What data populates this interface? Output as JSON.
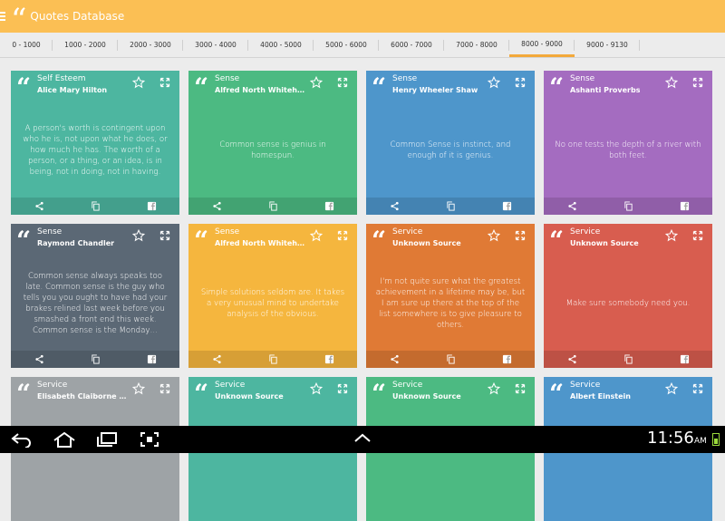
{
  "app": {
    "title": "Quotes Database",
    "logo_glyph": "“"
  },
  "tabs": [
    {
      "label": "0 - 1000",
      "active": false
    },
    {
      "label": "1000 - 2000",
      "active": false
    },
    {
      "label": "2000 - 3000",
      "active": false
    },
    {
      "label": "3000 - 4000",
      "active": false
    },
    {
      "label": "4000 - 5000",
      "active": false
    },
    {
      "label": "5000 - 6000",
      "active": false
    },
    {
      "label": "6000 - 7000",
      "active": false
    },
    {
      "label": "7000 - 8000",
      "active": false
    },
    {
      "label": "8000 - 9000",
      "active": true
    },
    {
      "label": "9000 - 9130",
      "active": false
    }
  ],
  "cards": [
    {
      "category": "Self Esteem",
      "author": "Alice Mary Hilton",
      "quote": "A person's worth is contingent upon who he is, not upon what he does, or how much he has. The worth of a person, or a thing, or an idea, is in being, not in doing, not in having.",
      "color": "#4db6a0"
    },
    {
      "category": "Sense",
      "author": "Alfred North Whitehead",
      "quote": "Common sense is genius in homespun.",
      "color": "#4cba82"
    },
    {
      "category": "Sense",
      "author": "Henry Wheeler Shaw",
      "quote": "Common Sense is instinct, and enough of it is genius.",
      "color": "#4e96cb"
    },
    {
      "category": "Sense",
      "author": "Ashanti Proverbs",
      "quote": "No one tests the depth of a river with both feet.",
      "color": "#a46cc0"
    },
    {
      "category": "Sense",
      "author": "Raymond Chandler",
      "quote": "Common sense always speaks too late. Common sense is the guy who tells you you ought to have had your brakes relined last week before you smashed a front end this week. Common sense is the Monday…",
      "color": "#5b6875"
    },
    {
      "category": "Sense",
      "author": "Alfred North Whitehead",
      "quote": "Simple solutions seldom are. It takes a very unusual mind to undertake analysis of the obvious.",
      "color": "#f5b63e"
    },
    {
      "category": "Service",
      "author": "Unknown Source",
      "quote": "I'm not quite sure what the greatest achievement in a lifetime may be, but I am sure up there at the top of the list somewhere is to give pleasure to others.",
      "color": "#e07a35"
    },
    {
      "category": "Service",
      "author": "Unknown Source",
      "quote": "Make sure somebody need you.",
      "color": "#d85d4f"
    },
    {
      "category": "Service",
      "author": "Elisabeth Claiborne Or...",
      "quote": "",
      "color": "#9ea3a6"
    },
    {
      "category": "Service",
      "author": "Unknown Source",
      "quote": "",
      "color": "#4db6a0"
    },
    {
      "category": "Service",
      "author": "Unknown Source",
      "quote": "",
      "color": "#4cba82"
    },
    {
      "category": "Service",
      "author": "Albert Einstein",
      "quote": "",
      "color": "#4e96cb"
    }
  ],
  "status_bar": {
    "time": "11:56",
    "ampm": "AM"
  },
  "colors": {
    "appbar": "#fbbf54",
    "tab_indicator": "#f3a93b",
    "battery": "#9cdc3c"
  }
}
